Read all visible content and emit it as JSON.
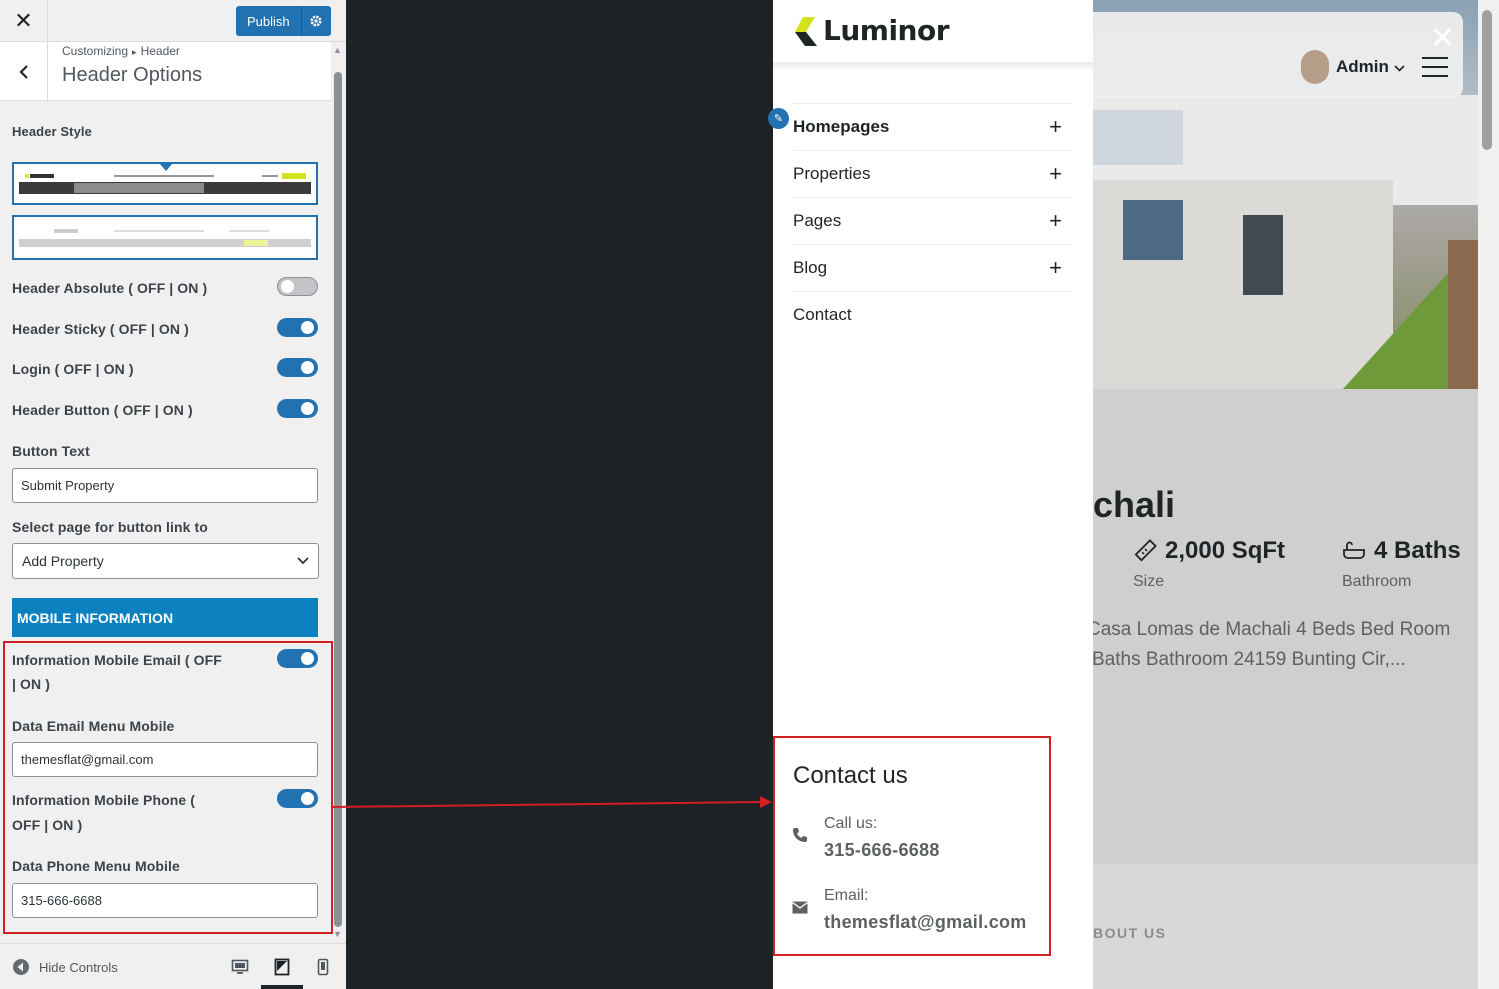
{
  "topbar": {
    "close": "✕",
    "publish": "Publish"
  },
  "section": {
    "crumb_root": "Customizing",
    "crumb_sep": "▸",
    "crumb_parent": "Header",
    "title": "Header Options"
  },
  "options": {
    "header_style_label": "Header Style",
    "header_absolute": {
      "label": "Header Absolute ( OFF | ON )",
      "on": false
    },
    "header_sticky": {
      "label": "Header Sticky ( OFF | ON )",
      "on": true
    },
    "login": {
      "label": "Login ( OFF | ON )",
      "on": true
    },
    "header_button": {
      "label": "Header Button ( OFF | ON )",
      "on": true
    },
    "button_text_label": "Button Text",
    "button_text_value": "Submit Property",
    "select_page_label": "Select page for button link to",
    "select_page_value": "Add Property"
  },
  "mobile": {
    "section_title": "MOBILE INFORMATION",
    "email_toggle_label_1": "Information Mobile Email ( OFF",
    "email_toggle_label_2": "| ON )",
    "email_on": true,
    "email_field_label": "Data Email Menu Mobile",
    "email_value": "themesflat@gmail.com",
    "phone_toggle_label_1": "Information Mobile Phone (",
    "phone_toggle_label_2": "OFF | ON )",
    "phone_on": true,
    "phone_field_label": "Data Phone Menu Mobile",
    "phone_value": "315-666-6688"
  },
  "footer": {
    "hide_controls": "Hide Controls"
  },
  "site": {
    "logo": "Luminor",
    "admin": "Admin",
    "menu": [
      {
        "label": "Homepages",
        "has_sub": true
      },
      {
        "label": "Properties",
        "has_sub": true
      },
      {
        "label": "Pages",
        "has_sub": true
      },
      {
        "label": "Blog",
        "has_sub": true
      },
      {
        "label": "Contact",
        "has_sub": false
      }
    ],
    "contact": {
      "title": "Contact us",
      "call_label": "Call us:",
      "call_value": "315-666-6688",
      "email_label": "Email:",
      "email_value": "themesflat@gmail.com"
    },
    "property": {
      "title_fragment": "chali",
      "size_value": "2,000 SqFt",
      "size_label": "Size",
      "baths_value": "4 Baths",
      "baths_label": "Bathroom",
      "desc_line1": "Casa Lomas de Machali 4 Beds Bed Room",
      "desc_line2": "Baths Bathroom 24159 Bunting Cir,..."
    },
    "about_fragment": "BOUT US"
  },
  "colors": {
    "accent": "#2271b1",
    "section_blue": "#0b82bf",
    "highlight_red": "#d31f26",
    "logo_yellow": "#d6e21f"
  }
}
